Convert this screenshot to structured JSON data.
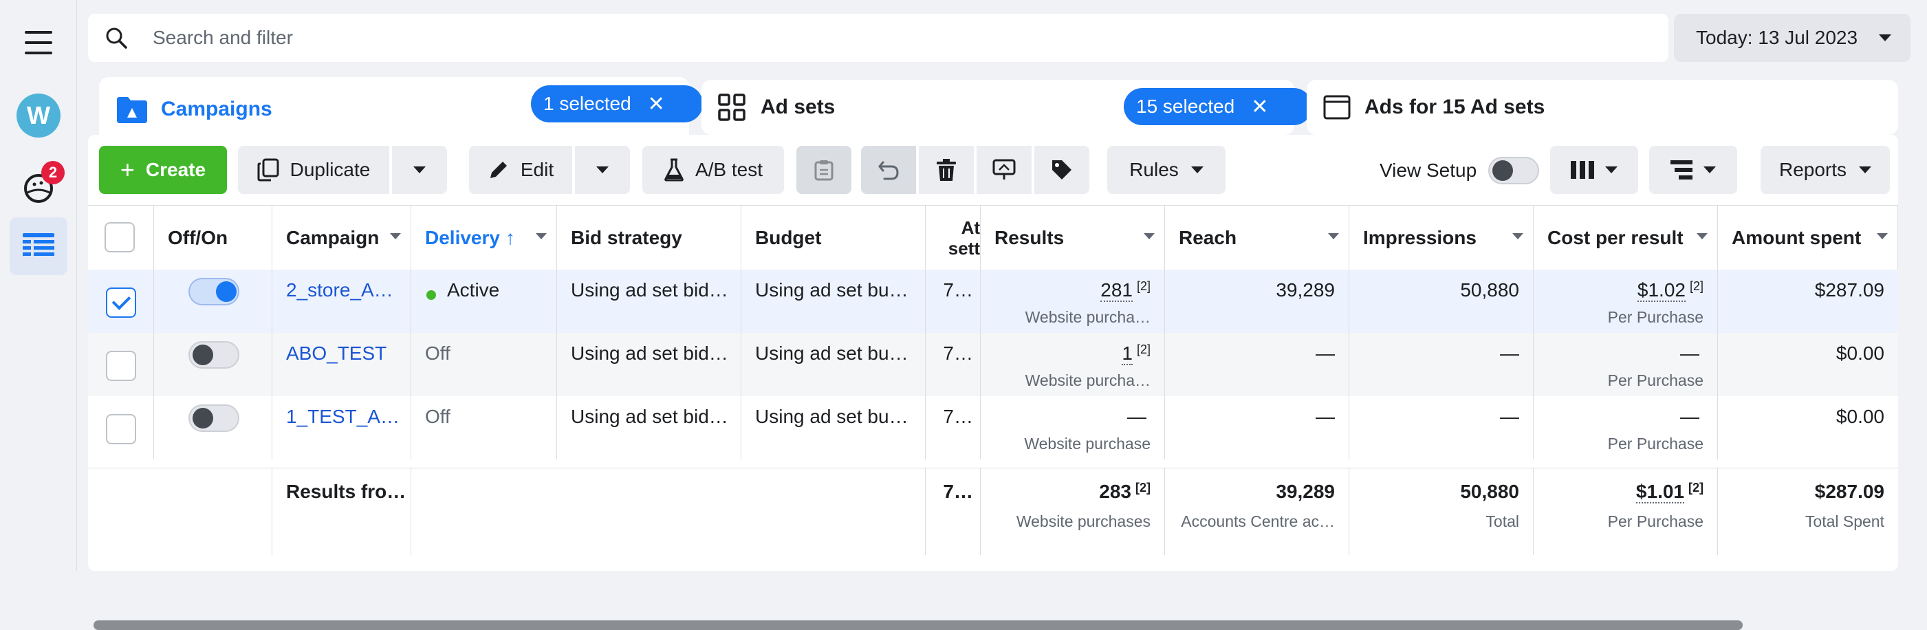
{
  "search": {
    "placeholder": "Search and filter"
  },
  "date_picker": {
    "label": "Today: 13 Jul 2023"
  },
  "rail": {
    "avatar_letter": "W",
    "notification_count": "2"
  },
  "tabs": [
    {
      "label": "Campaigns",
      "pill": "1 selected"
    },
    {
      "label": "Ad sets",
      "pill": "15 selected"
    },
    {
      "label": "Ads for 15 Ad sets"
    }
  ],
  "toolbar": {
    "create": "Create",
    "duplicate": "Duplicate",
    "edit": "Edit",
    "ab_test": "A/B test",
    "rules": "Rules",
    "view_setup": "View Setup",
    "reports": "Reports"
  },
  "columns": [
    "Off/On",
    "Campaign",
    "Delivery",
    "Bid strategy",
    "Budget",
    "At sett",
    "Results",
    "Reach",
    "Impressions",
    "Cost per result",
    "Amount spent"
  ],
  "rows": [
    {
      "selected": true,
      "on": true,
      "campaign": "2_store_A…",
      "delivery": "Active",
      "bid": "Using ad set bid…",
      "budget": "Using ad set bu…",
      "attr": "7…",
      "results": "281",
      "results_sup": "[2]",
      "results_sub": "Website purcha…",
      "reach": "39,289",
      "impressions": "50,880",
      "cpr": "$1.02",
      "cpr_sup": "[2]",
      "cpr_sub": "Per Purchase",
      "spent": "$287.09"
    },
    {
      "selected": false,
      "on": false,
      "campaign": "ABO_TEST",
      "delivery": "Off",
      "bid": "Using ad set bid…",
      "budget": "Using ad set bu…",
      "attr": "7…",
      "results": "1",
      "results_sup": "[2]",
      "results_sub": "Website purcha…",
      "reach": "—",
      "impressions": "—",
      "cpr": "—",
      "cpr_sup": "",
      "cpr_sub": "Per Purchase",
      "spent": "$0.00"
    },
    {
      "selected": false,
      "on": false,
      "campaign": "1_TEST_A…",
      "delivery": "Off",
      "bid": "Using ad set bid…",
      "budget": "Using ad set bu…",
      "attr": "7…",
      "results": "—",
      "results_sup": "",
      "results_sub": "Website purchase",
      "reach": "—",
      "impressions": "—",
      "cpr": "—",
      "cpr_sup": "",
      "cpr_sub": "Per Purchase",
      "spent": "$0.00"
    }
  ],
  "totals": {
    "label": "Results fro…",
    "attr": "7…",
    "results": "283",
    "results_sup": "[2]",
    "results_sub": "Website purchases",
    "reach": "39,289",
    "reach_sub": "Accounts Centre ac…",
    "impressions": "50,880",
    "impressions_sub": "Total",
    "cpr": "$1.01",
    "cpr_sup": "[2]",
    "cpr_sub": "Per Purchase",
    "spent": "$287.09",
    "spent_sub": "Total Spent"
  },
  "colors": {
    "accent": "#1877f2",
    "create": "#42b72a",
    "link": "#1a55d4",
    "active_dot": "#42b72a",
    "selected_row": "#edf3fe"
  }
}
